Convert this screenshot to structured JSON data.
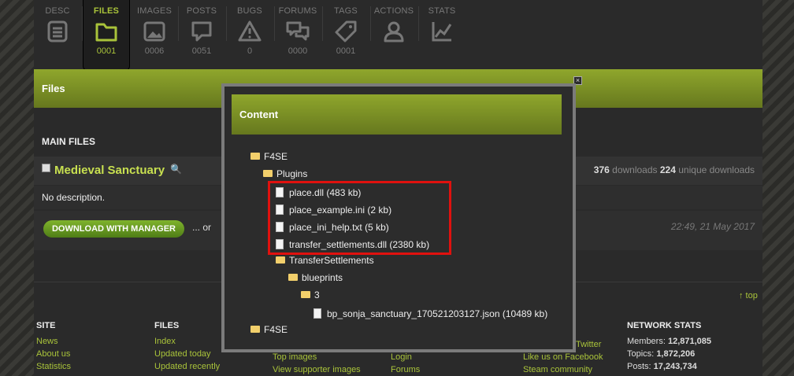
{
  "tabs": [
    {
      "label": "DESC",
      "count": "",
      "icon": "document-icon"
    },
    {
      "label": "FILES",
      "count": "0001",
      "icon": "folder-icon"
    },
    {
      "label": "IMAGES",
      "count": "0006",
      "icon": "image-icon"
    },
    {
      "label": "POSTS",
      "count": "0051",
      "icon": "speech-bubble-icon"
    },
    {
      "label": "BUGS",
      "count": "0",
      "icon": "warning-icon"
    },
    {
      "label": "FORUMS",
      "count": "0000",
      "icon": "chat-bubbles-icon"
    },
    {
      "label": "TAGS",
      "count": "0001",
      "icon": "tag-icon"
    },
    {
      "label": "ACTIONS",
      "count": "",
      "icon": "user-icon"
    },
    {
      "label": "STATS",
      "count": "",
      "icon": "chart-icon"
    }
  ],
  "files_header": "Files",
  "main_files": "MAIN FILES",
  "file": {
    "name": "Medieval Sanctuary",
    "downloads": "376",
    "downloads_label": "downloads",
    "unique": "224",
    "unique_label": "unique downloads",
    "description": "No description.",
    "download_button": "DOWNLOAD WITH MANAGER",
    "or_text": "... or",
    "date": "22:49, 21 May 2017"
  },
  "top_link": "↑ top",
  "footer": {
    "site": {
      "title": "SITE",
      "items": [
        "News",
        "About us",
        "Statistics"
      ]
    },
    "files": {
      "title": "FILES",
      "items": [
        "Index",
        "Updated today",
        "Updated recently"
      ]
    },
    "images": {
      "items": [
        "Top images",
        "View supporter images"
      ]
    },
    "account": {
      "items": [
        "Login",
        "Forums"
      ]
    },
    "social": {
      "items": [
        "Twitter",
        "Like us on Facebook",
        "Steam community"
      ]
    },
    "network": {
      "title": "NETWORK STATS",
      "members_label": "Members:",
      "members": "12,871,085",
      "topics_label": "Topics:",
      "topics": "1,872,206",
      "posts_label": "Posts:",
      "posts": "17,243,734"
    }
  },
  "modal": {
    "title": "Content",
    "close": "×",
    "tree": [
      {
        "name": "F4SE",
        "type": "folder"
      },
      {
        "name": "Plugins",
        "type": "folder"
      },
      {
        "name": "place.dll (483 kb)",
        "type": "file"
      },
      {
        "name": "place_example.ini (2 kb)",
        "type": "file"
      },
      {
        "name": "place_ini_help.txt (5 kb)",
        "type": "file"
      },
      {
        "name": "transfer_settlements.dll (2380 kb)",
        "type": "file"
      },
      {
        "name": "TransferSettlements",
        "type": "folder"
      },
      {
        "name": "blueprints",
        "type": "folder"
      },
      {
        "name": "3",
        "type": "folder"
      },
      {
        "name": "bp_sonja_sanctuary_170521203127.json (10489 kb)",
        "type": "file"
      },
      {
        "name": "F4SE",
        "type": "folder"
      }
    ]
  },
  "colors": {
    "accent": "#a9c33a",
    "highlight": "#e0110e",
    "bar": "#8fa62c"
  }
}
